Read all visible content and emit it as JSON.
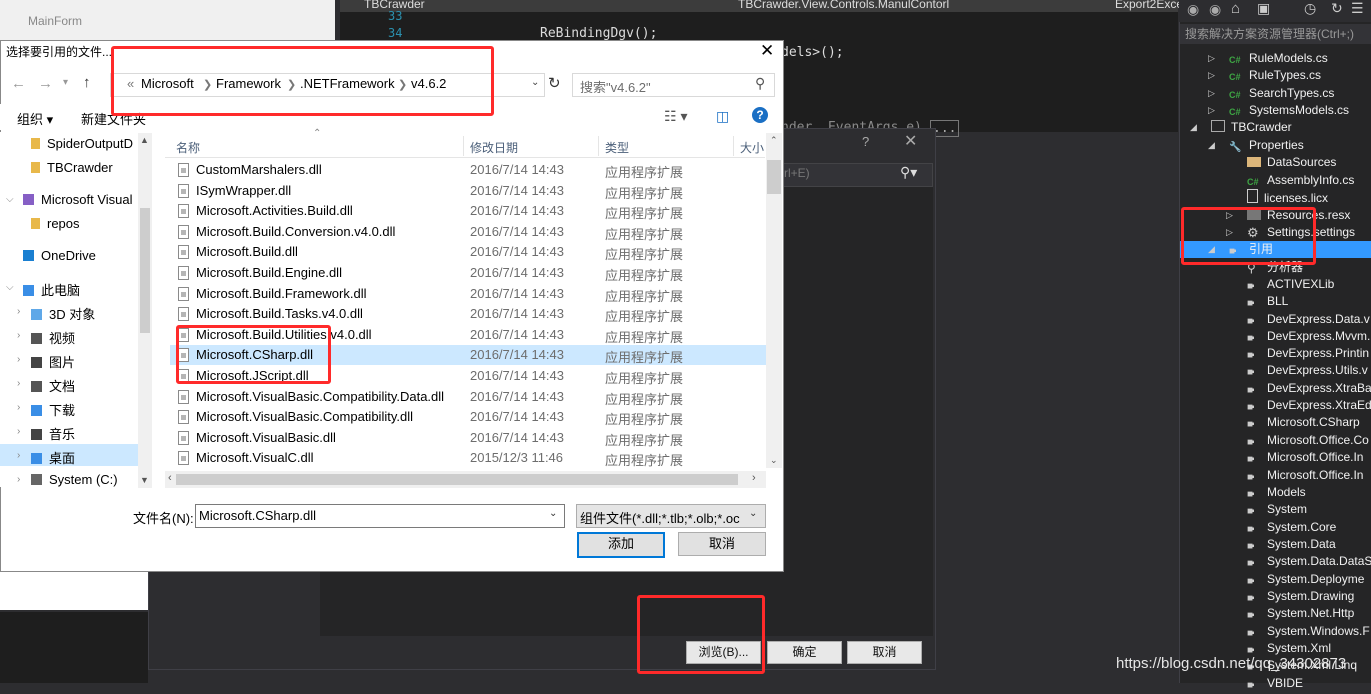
{
  "background": {
    "mainform_title": "MainForm",
    "editor_tabs": [
      "TBCrawder",
      "TBCrawder.View.Controls.ManulContorl",
      "Export2Exce"
    ],
    "line_numbers": [
      "33",
      "34"
    ],
    "code_lines": [
      "ReBindingDgv();",
      "dels>();",
      "nder, EventArgs e)"
    ],
    "code_ellipsis": "..."
  },
  "reference_manager": {
    "help": "?",
    "close": "✕",
    "search_hint": "rl+E)",
    "browse_label": "浏览(B)...",
    "ok_label": "确定",
    "cancel_label": "取消"
  },
  "solution_explorer": {
    "search_placeholder": "搜索解决方案资源管理器(Ctrl+;)",
    "items": [
      {
        "label": "RuleModels.cs",
        "icon": "cs"
      },
      {
        "label": "RuleTypes.cs",
        "icon": "cs"
      },
      {
        "label": "SearchTypes.cs",
        "icon": "cs"
      },
      {
        "label": "SystemsModels.cs",
        "icon": "cs"
      },
      {
        "label": "TBCrawder",
        "icon": "project"
      },
      {
        "label": "Properties",
        "icon": "wrench"
      },
      {
        "label": "DataSources",
        "icon": "folder"
      },
      {
        "label": "AssemblyInfo.cs",
        "icon": "cs"
      },
      {
        "label": "licenses.licx",
        "icon": "file"
      },
      {
        "label": "Resources.resx",
        "icon": "resx"
      },
      {
        "label": "Settings.settings",
        "icon": "gear"
      },
      {
        "label": "引用",
        "icon": "ref"
      },
      {
        "label": "分析器",
        "icon": "analyzer"
      },
      {
        "label": "ACTIVEXLib",
        "icon": "ref"
      },
      {
        "label": "BLL",
        "icon": "ref"
      },
      {
        "label": "DevExpress.Data.v",
        "icon": "ref"
      },
      {
        "label": "DevExpress.Mvvm.",
        "icon": "ref"
      },
      {
        "label": "DevExpress.Printin",
        "icon": "ref"
      },
      {
        "label": "DevExpress.Utils.v",
        "icon": "ref"
      },
      {
        "label": "DevExpress.XtraBa",
        "icon": "ref"
      },
      {
        "label": "DevExpress.XtraEd",
        "icon": "ref"
      },
      {
        "label": "Microsoft.CSharp",
        "icon": "ref"
      },
      {
        "label": "Microsoft.Office.Co",
        "icon": "ref"
      },
      {
        "label": "Microsoft.Office.In",
        "icon": "ref"
      },
      {
        "label": "Microsoft.Office.In",
        "icon": "ref"
      },
      {
        "label": "Models",
        "icon": "ref"
      },
      {
        "label": "System",
        "icon": "ref"
      },
      {
        "label": "System.Core",
        "icon": "ref"
      },
      {
        "label": "System.Data",
        "icon": "ref"
      },
      {
        "label": "System.Data.DataS",
        "icon": "ref"
      },
      {
        "label": "System.Deployme",
        "icon": "ref"
      },
      {
        "label": "System.Drawing",
        "icon": "ref"
      },
      {
        "label": "System.Net.Http",
        "icon": "ref"
      },
      {
        "label": "System.Windows.F",
        "icon": "ref"
      },
      {
        "label": "System.Xml",
        "icon": "ref"
      },
      {
        "label": "System.Xml.Linq",
        "icon": "ref"
      },
      {
        "label": "VBIDE",
        "icon": "ref"
      }
    ]
  },
  "dialog": {
    "title": "选择要引用的文件...",
    "close": "✕",
    "breadcrumb": [
      "«",
      "Microsoft",
      "Framework",
      ".NETFramework",
      "v4.6.2"
    ],
    "search_placeholder": "搜索\"v4.6.2\"",
    "organize": "组织 ▾",
    "new_folder": "新建文件夹",
    "nav": [
      "SpiderOutputD",
      "TBCrawder",
      "Microsoft Visual",
      "repos",
      "OneDrive",
      "此电脑",
      "3D 对象",
      "视频",
      "图片",
      "文档",
      "下载",
      "音乐",
      "桌面",
      "System (C:)"
    ],
    "columns": {
      "name": "名称",
      "date": "修改日期",
      "type": "类型",
      "size": "大小"
    },
    "files": [
      {
        "name": "CustomMarshalers.dll",
        "date": "2016/7/14 14:43",
        "type": "应用程序扩展"
      },
      {
        "name": "ISymWrapper.dll",
        "date": "2016/7/14 14:43",
        "type": "应用程序扩展"
      },
      {
        "name": "Microsoft.Activities.Build.dll",
        "date": "2016/7/14 14:43",
        "type": "应用程序扩展"
      },
      {
        "name": "Microsoft.Build.Conversion.v4.0.dll",
        "date": "2016/7/14 14:43",
        "type": "应用程序扩展"
      },
      {
        "name": "Microsoft.Build.dll",
        "date": "2016/7/14 14:43",
        "type": "应用程序扩展"
      },
      {
        "name": "Microsoft.Build.Engine.dll",
        "date": "2016/7/14 14:43",
        "type": "应用程序扩展"
      },
      {
        "name": "Microsoft.Build.Framework.dll",
        "date": "2016/7/14 14:43",
        "type": "应用程序扩展"
      },
      {
        "name": "Microsoft.Build.Tasks.v4.0.dll",
        "date": "2016/7/14 14:43",
        "type": "应用程序扩展"
      },
      {
        "name": "Microsoft.Build.Utilities.v4.0.dll",
        "date": "2016/7/14 14:43",
        "type": "应用程序扩展"
      },
      {
        "name": "Microsoft.CSharp.dll",
        "date": "2016/7/14 14:43",
        "type": "应用程序扩展"
      },
      {
        "name": "Microsoft.JScript.dll",
        "date": "2016/7/14 14:43",
        "type": "应用程序扩展"
      },
      {
        "name": "Microsoft.VisualBasic.Compatibility.Data.dll",
        "date": "2016/7/14 14:43",
        "type": "应用程序扩展"
      },
      {
        "name": "Microsoft.VisualBasic.Compatibility.dll",
        "date": "2016/7/14 14:43",
        "type": "应用程序扩展"
      },
      {
        "name": "Microsoft.VisualBasic.dll",
        "date": "2016/7/14 14:43",
        "type": "应用程序扩展"
      },
      {
        "name": "Microsoft.VisualC.dll",
        "date": "2015/12/3 11:46",
        "type": "应用程序扩展"
      }
    ],
    "selected_file": "Microsoft.CSharp.dll",
    "filename_label": "文件名(N):",
    "filename_value": "Microsoft.CSharp.dll",
    "filter_value": "组件文件(*.dll;*.tlb;*.olb;*.ocx;",
    "add_label": "添加",
    "cancel_label": "取消"
  },
  "watermark": "https://blog.csdn.net/qq_34302873",
  "colors": {
    "highlight_box": "#ff2a2a",
    "selection": "#cce8ff",
    "vs_selection": "#3399ff"
  }
}
